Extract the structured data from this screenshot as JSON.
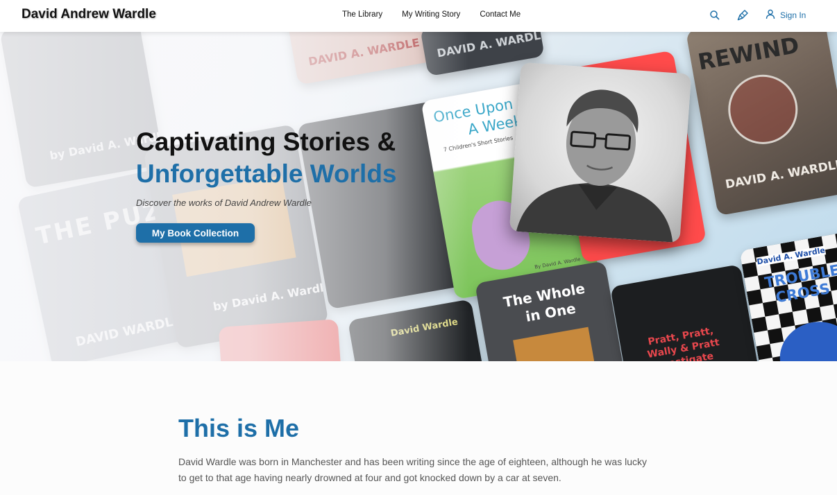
{
  "header": {
    "brand": "David Andrew Wardle",
    "nav": [
      "The Library",
      "My Writing Story",
      "Contact Me"
    ],
    "sign_in": "Sign In",
    "icons": [
      "search-icon",
      "brush-icon",
      "user-icon"
    ],
    "accent_color": "#1e6fa8"
  },
  "hero": {
    "title_line1": "Captivating Stories &",
    "title_line2": "Unforgettable Worlds",
    "subtitle": "Discover the works of David Andrew Wardle",
    "button_label": "My Book Collection"
  },
  "books": {
    "rewind_title": "REWIND",
    "rewind_author": "DAVID A. WARDLE",
    "once_upon_title_1": "Once Upon",
    "once_upon_title_2": "A Week",
    "once_upon_subtitle": "7 Children's Short Stories",
    "once_upon_author": "By David A. Wardle",
    "whole_title_1": "The Whole",
    "whole_title_2": "in One",
    "pratt_title_1": "Pratt, Pratt,",
    "pratt_title_2": "Wally & Pratt",
    "pratt_title_3": "Investigate",
    "trouble_title_1": "TROUBLE",
    "trouble_title_2": "CROSS",
    "trouble_author": "David A. Wardle",
    "puzzle_title": "THE PUZZLE",
    "faded_author_1": "DAVID A. WARDLE",
    "faded_author_2": "by David A. Wardle",
    "faded_author_3": "DAVID WARDLE",
    "faded_author_4": "David Wardle"
  },
  "about": {
    "title": "This is Me",
    "text": "David Wardle was born in Manchester and has been writing since the age of eighteen, although he was lucky to get to that age having nearly drowned at four and got knocked down by a car at seven."
  }
}
